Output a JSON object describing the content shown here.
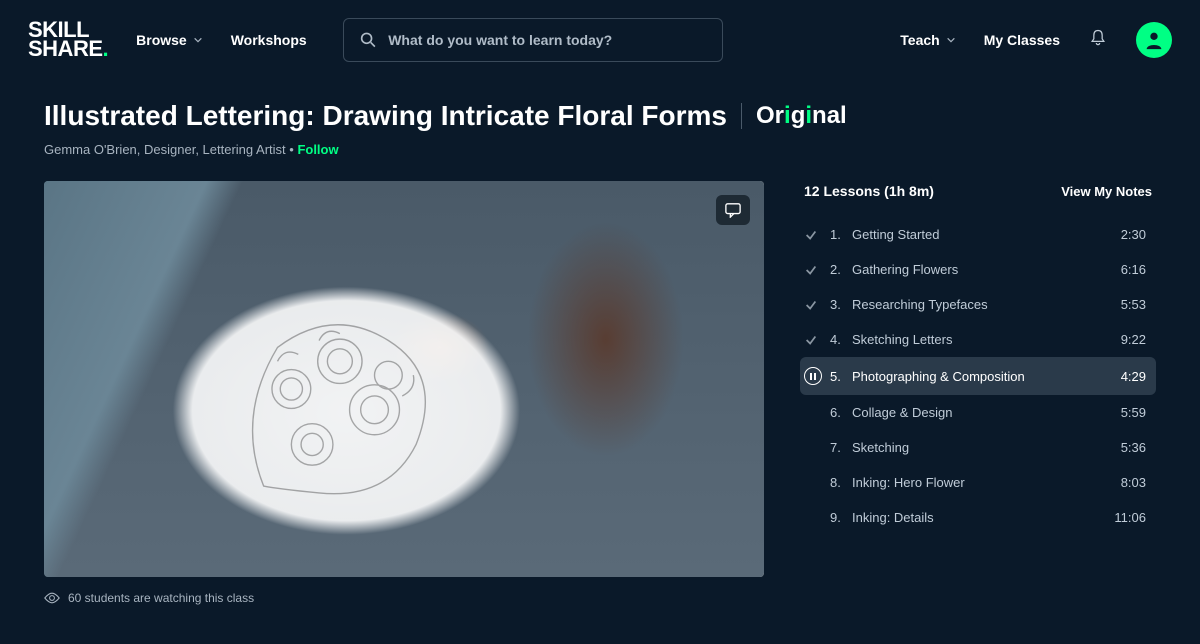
{
  "header": {
    "browse": "Browse",
    "workshops": "Workshops",
    "search_placeholder": "What do you want to learn today?",
    "teach": "Teach",
    "my_classes": "My Classes"
  },
  "course": {
    "title": "Illustrated Lettering: Drawing Intricate Floral Forms",
    "badge_prefix": "Or",
    "badge_i1": "i",
    "badge_mid": "g",
    "badge_i2": "i",
    "badge_suffix": "nal",
    "author": "Gemma O'Brien, Designer, Lettering Artist",
    "follow": "Follow",
    "watching": "60 students are watching this class"
  },
  "lessons": {
    "header": "12 Lessons (1h 8m)",
    "notes_label": "View My Notes",
    "items": [
      {
        "num": "1.",
        "title": "Getting Started",
        "dur": "2:30",
        "status": "done"
      },
      {
        "num": "2.",
        "title": "Gathering Flowers",
        "dur": "6:16",
        "status": "done"
      },
      {
        "num": "3.",
        "title": "Researching Typefaces",
        "dur": "5:53",
        "status": "done"
      },
      {
        "num": "4.",
        "title": "Sketching Letters",
        "dur": "9:22",
        "status": "done"
      },
      {
        "num": "5.",
        "title": "Photographing & Composition",
        "dur": "4:29",
        "status": "playing"
      },
      {
        "num": "6.",
        "title": "Collage & Design",
        "dur": "5:59",
        "status": "pending"
      },
      {
        "num": "7.",
        "title": "Sketching",
        "dur": "5:36",
        "status": "pending"
      },
      {
        "num": "8.",
        "title": "Inking: Hero Flower",
        "dur": "8:03",
        "status": "pending"
      },
      {
        "num": "9.",
        "title": "Inking: Details",
        "dur": "11:06",
        "status": "pending"
      }
    ]
  }
}
